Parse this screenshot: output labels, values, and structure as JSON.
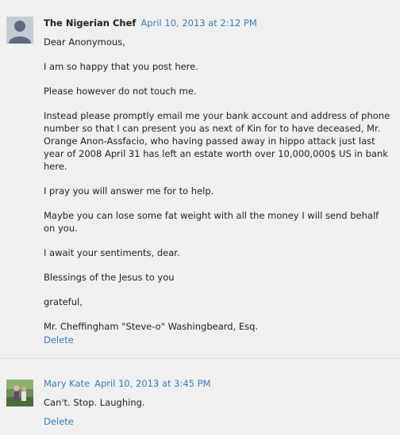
{
  "comments": [
    {
      "author": "The Nigerian Chef",
      "date": "April 10, 2013 at 2:12 PM",
      "paragraphs": [
        "Dear Anonymous,",
        "I am so happy that you post here.",
        "Please however do not touch me.",
        "Instead please promptly email me your bank account and address of phone number so that I can present you as next of Kin for to have deceased, Mr. Orange Anon-Assfacio, who having passed away in hippo attack just last year of 2008 April 31 has left an estate worth over 10,000,000$ US in bank here.",
        "I pray you will answer me for to help.",
        "Maybe you can lose some fat weight with all the money I will send behalf on you.",
        "I await your sentiments, dear.",
        "Blessings of the Jesus to you",
        "grateful,",
        "Mr. Cheffingham \"Steve-o\" Washingbeard, Esq."
      ],
      "delete_label": "Delete",
      "avatar_icon": "default-user-icon"
    },
    {
      "author": "Mary Kate",
      "date": "April 10, 2013 at 3:45 PM",
      "paragraphs": [
        "Can't. Stop. Laughing."
      ],
      "delete_label": "Delete",
      "avatar_icon": "user-photo"
    }
  ],
  "colors": {
    "link": "#3a7ab8",
    "text": "#222222",
    "background": "#f0f0f0"
  }
}
